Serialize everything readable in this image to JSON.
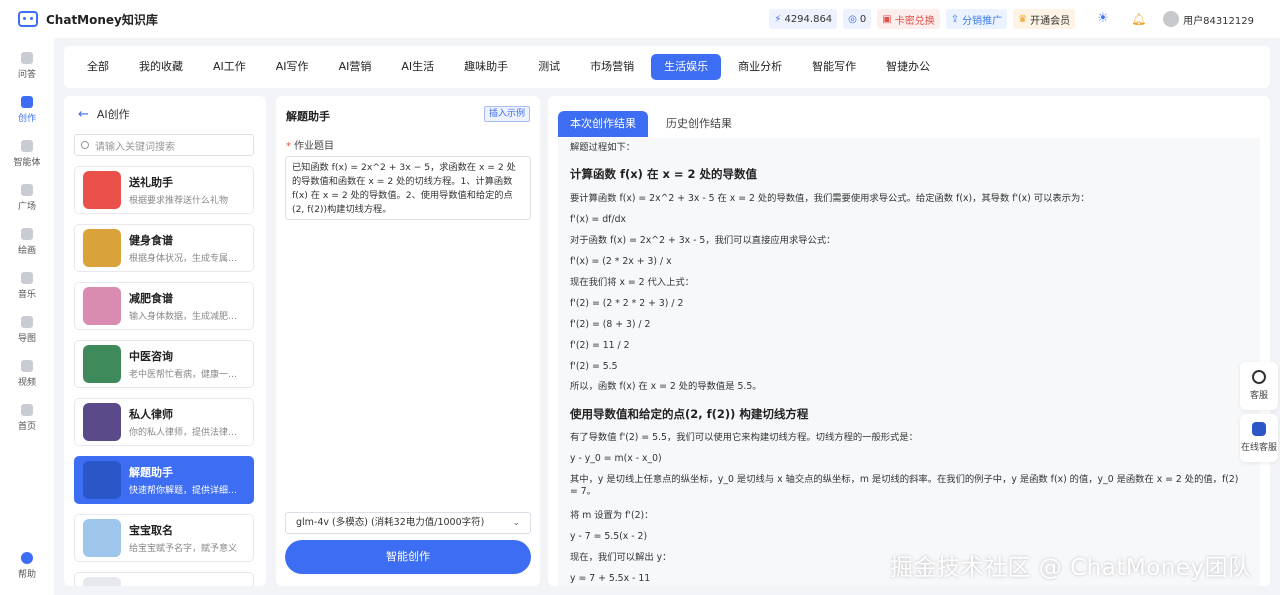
{
  "app": {
    "title": "ChatMoney知识库"
  },
  "topbar": {
    "balance": "4294.864",
    "points": "0",
    "redeem": "卡密兑换",
    "distribute": "分销推广",
    "member": "开通会员",
    "user": "用户84312129"
  },
  "nav": [
    {
      "label": "问答",
      "icon": "chat-icon"
    },
    {
      "label": "创作",
      "icon": "pen-icon",
      "active": true
    },
    {
      "label": "智能体",
      "icon": "agent-icon"
    },
    {
      "label": "广场",
      "icon": "grid-icon"
    },
    {
      "label": "绘画",
      "icon": "palette-icon"
    },
    {
      "label": "音乐",
      "icon": "music-icon"
    },
    {
      "label": "导图",
      "icon": "mindmap-icon"
    },
    {
      "label": "视频",
      "icon": "video-icon"
    },
    {
      "label": "首页",
      "icon": "home-icon"
    },
    {
      "label": "帮助",
      "icon": "help-icon"
    }
  ],
  "categories": [
    "全部",
    "我的收藏",
    "AI工作",
    "AI写作",
    "AI营销",
    "AI生活",
    "趣味助手",
    "测试",
    "市场营销",
    "生活娱乐",
    "商业分析",
    "智能写作",
    "智捷办公"
  ],
  "active_category": "生活娱乐",
  "left": {
    "title": "AI创作",
    "search_placeholder": "请输入关键词搜索",
    "cards": [
      {
        "title": "送礼助手",
        "desc": "根据要求推荐送什么礼物",
        "color": "#e9504a"
      },
      {
        "title": "健身食谱",
        "desc": "根据身体状况，生成专属…",
        "color": "#d9a23a"
      },
      {
        "title": "减肥食谱",
        "desc": "输入身体数据，生成减肥…",
        "color": "#d98bb0"
      },
      {
        "title": "中医咨询",
        "desc": "老中医帮忙看病，健康一…",
        "color": "#3f8a5a"
      },
      {
        "title": "私人律师",
        "desc": "你的私人律师，提供法律…",
        "color": "#5a4a8a"
      },
      {
        "title": "解题助手",
        "desc": "快速帮你解题，提供详细…",
        "color": "#2a56c8",
        "active": true
      },
      {
        "title": "宝宝取名",
        "desc": "给宝宝赋予名字，赋予意义",
        "color": "#9ec5ea"
      }
    ]
  },
  "middle": {
    "title": "解题助手",
    "insert_example": "插入示例",
    "field_label": "作业题目",
    "field_value": "已知函数 f(x) = 2x^2 + 3x − 5，求函数在 x = 2 处的导数值和函数在 x = 2 处的切线方程。1、计算函数 f(x) 在 x = 2 处的导数值。2、使用导数值和给定的点(2, f(2))构建切线方程。",
    "model": "glm-4v (多模态) (消耗32电力值/1000字符)",
    "submit": "智能创作"
  },
  "right": {
    "tab_current": "本次创作结果",
    "tab_history": "历史创作结果",
    "lines": [
      {
        "type": "p",
        "text": "解题过程如下："
      },
      {
        "type": "h",
        "text": "计算函数 f(x) 在 x = 2 处的导数值"
      },
      {
        "type": "p",
        "text": "要计算函数 f(x) = 2x^2 + 3x - 5 在 x = 2 处的导数值，我们需要使用求导公式。给定函数 f(x)，其导数 f'(x) 可以表示为："
      },
      {
        "type": "p",
        "text": "f'(x) = df/dx"
      },
      {
        "type": "p",
        "text": "对于函数 f(x) = 2x^2 + 3x - 5，我们可以直接应用求导公式："
      },
      {
        "type": "p",
        "text": "f'(x) = (2 * 2x + 3) / x"
      },
      {
        "type": "p",
        "text": "现在我们将 x = 2 代入上式："
      },
      {
        "type": "p",
        "text": "f'(2) = (2 * 2 * 2 + 3) / 2"
      },
      {
        "type": "p",
        "text": "f'(2) = (8 + 3) / 2"
      },
      {
        "type": "p",
        "text": "f'(2) = 11 / 2"
      },
      {
        "type": "p",
        "text": "f'(2) = 5.5"
      },
      {
        "type": "p",
        "text": "所以，函数 f(x) 在 x = 2 处的导数值是 5.5。"
      },
      {
        "type": "h",
        "text": "使用导数值和给定的点(2, f(2)) 构建切线方程"
      },
      {
        "type": "p",
        "text": "有了导数值 f'(2) = 5.5，我们可以使用它来构建切线方程。切线方程的一般形式是："
      },
      {
        "type": "p",
        "text": "y - y_0 = m(x - x_0)"
      },
      {
        "type": "p",
        "text": "其中，y 是切线上任意点的纵坐标，y_0 是切线与 x 轴交点的纵坐标，m 是切线的斜率。在我们的例子中，y 是函数 f(x) 的值，y_0 是函数在 x = 2 处的值，f(2) = 7。"
      },
      {
        "type": "p",
        "text": "将 m 设置为 f'(2)："
      },
      {
        "type": "p",
        "text": "y - 7 = 5.5(x - 2)"
      },
      {
        "type": "p",
        "text": "现在，我们可以解出 y："
      },
      {
        "type": "p",
        "text": "y = 7 + 5.5x - 11"
      }
    ]
  },
  "float": {
    "service": "客服",
    "online": "在线客服"
  },
  "watermark": "掘金技术社区 @ ChatMoney团队"
}
